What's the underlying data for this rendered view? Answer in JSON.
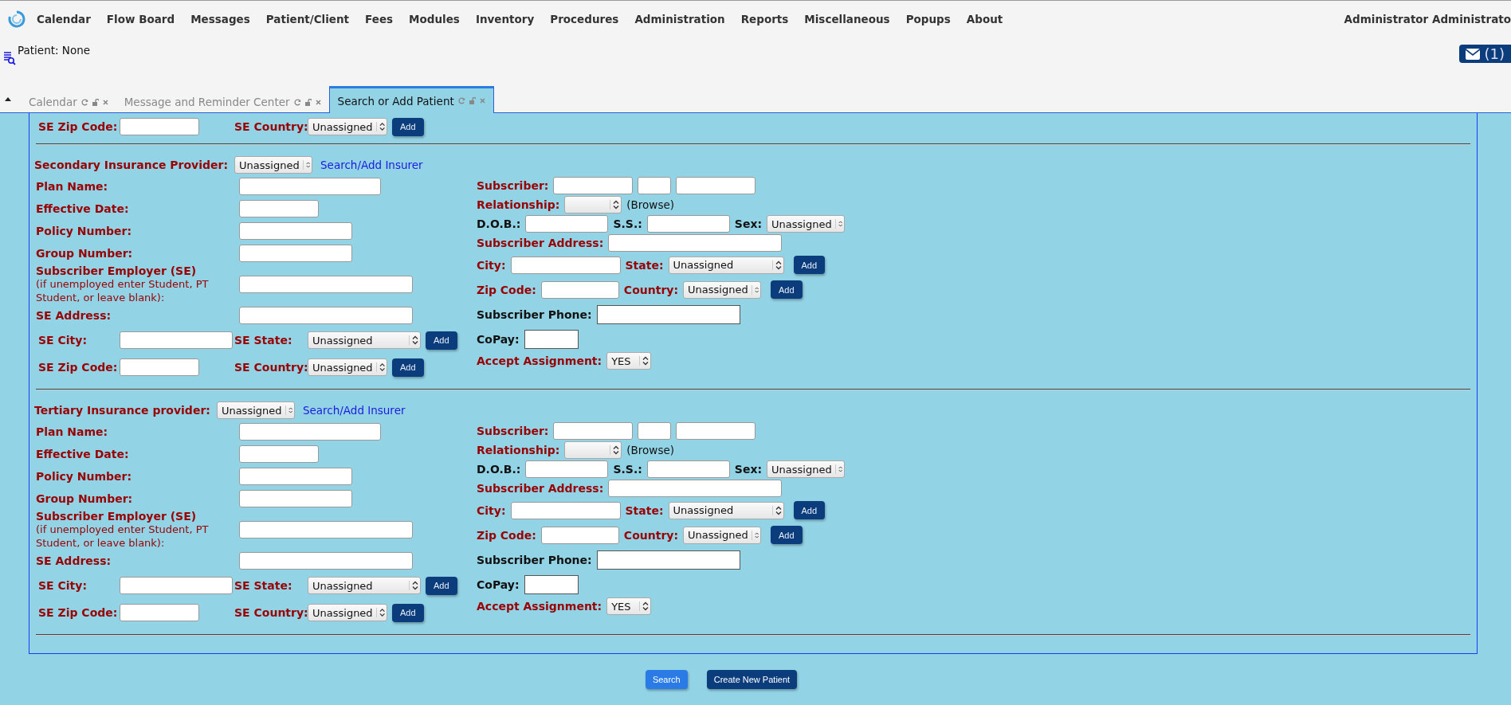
{
  "nav": {
    "menu": [
      "Calendar",
      "Flow Board",
      "Messages",
      "Patient/Client",
      "Fees",
      "Modules",
      "Inventory",
      "Procedures",
      "Administration",
      "Reports",
      "Miscellaneous",
      "Popups",
      "About"
    ],
    "user": "Administrator Administrato"
  },
  "patient_bar": {
    "label": "Patient: None",
    "messages": "(1)"
  },
  "tabs": [
    {
      "label": "Calendar",
      "selected": false
    },
    {
      "label": "Message and Reminder Center",
      "selected": false
    },
    {
      "label": "Search or Add Patient",
      "selected": true
    }
  ],
  "top_row": {
    "items": [
      {
        "kind": "label",
        "text": "SE Zip Code:",
        "required": true
      },
      {
        "kind": "input"
      },
      {
        "kind": "label",
        "text": "SE Country:",
        "required": true
      },
      {
        "kind": "select",
        "value": "Unassigned"
      },
      {
        "kind": "button",
        "text": "Add"
      }
    ]
  },
  "sections": [
    {
      "title": "Secondary Insurance Provider:",
      "provider": "Unassigned",
      "link": "Search/Add Insurer",
      "left_rows": [
        {
          "kind": "pair",
          "label": "Plan Name:"
        },
        {
          "kind": "pair",
          "label": "Effective Date:"
        },
        {
          "kind": "pair",
          "label": "Policy Number:"
        },
        {
          "kind": "pair",
          "label": "Group Number:"
        },
        {
          "kind": "pair",
          "label": "Subscriber Employer (SE)",
          "note": "(if unemployed enter Student, PT Student, or leave blank):"
        },
        {
          "kind": "pair",
          "label": "SE Address:"
        },
        {
          "kind": "inline",
          "items": [
            {
              "kind": "label",
              "text": "SE City:",
              "required": true
            },
            {
              "kind": "input"
            },
            {
              "kind": "label",
              "text": "SE State:",
              "required": true
            },
            {
              "kind": "select",
              "value": "Unassigned"
            },
            {
              "kind": "button",
              "text": "Add"
            }
          ]
        },
        {
          "kind": "inline",
          "items": [
            {
              "kind": "label",
              "text": "SE Zip Code:",
              "required": true
            },
            {
              "kind": "input"
            },
            {
              "kind": "label",
              "text": "SE Country:",
              "required": true
            },
            {
              "kind": "select",
              "value": "Unassigned"
            },
            {
              "kind": "button",
              "text": "Add"
            }
          ]
        }
      ],
      "right_rows": [
        {
          "items": [
            {
              "kind": "label",
              "text": "Subscriber:",
              "required": true
            },
            {
              "kind": "input"
            },
            {
              "kind": "input"
            },
            {
              "kind": "input"
            }
          ]
        },
        {
          "items": [
            {
              "kind": "label",
              "text": "Relationship:",
              "required": true
            },
            {
              "kind": "select"
            },
            {
              "kind": "note",
              "text": "(Browse)"
            }
          ]
        },
        {
          "items": [
            {
              "kind": "label",
              "text": "D.O.B.:",
              "required": false
            },
            {
              "kind": "input"
            },
            {
              "kind": "label",
              "text": "S.S.:",
              "required": false
            },
            {
              "kind": "input"
            },
            {
              "kind": "label",
              "text": "Sex:",
              "required": false
            },
            {
              "kind": "select",
              "value": "Unassigned"
            }
          ]
        },
        {
          "items": [
            {
              "kind": "label",
              "text": "Subscriber Address:",
              "required": true
            },
            {
              "kind": "input"
            }
          ]
        },
        {
          "items": [
            {
              "kind": "label",
              "text": "City:",
              "required": true
            },
            {
              "kind": "input"
            },
            {
              "kind": "label",
              "text": "State:",
              "required": true
            },
            {
              "kind": "select",
              "value": "Unassigned"
            },
            {
              "kind": "button",
              "text": "Add"
            }
          ]
        },
        {
          "items": [
            {
              "kind": "label",
              "text": "Zip Code:",
              "required": true
            },
            {
              "kind": "input"
            },
            {
              "kind": "label",
              "text": "Country:",
              "required": true
            },
            {
              "kind": "select",
              "value": "Unassigned"
            },
            {
              "kind": "button",
              "text": "Add"
            }
          ]
        },
        {
          "items": [
            {
              "kind": "label",
              "text": "Subscriber Phone:",
              "required": false
            },
            {
              "kind": "box"
            }
          ]
        },
        {
          "items": [
            {
              "kind": "label",
              "text": "CoPay:",
              "required": false
            },
            {
              "kind": "box"
            }
          ]
        },
        {
          "items": [
            {
              "kind": "label",
              "text": "Accept Assignment:",
              "required": true
            },
            {
              "kind": "select",
              "value": "YES"
            }
          ]
        }
      ]
    },
    {
      "title": "Tertiary Insurance provider:",
      "provider": "Unassigned",
      "link": "Search/Add Insurer",
      "left_rows": [
        {
          "kind": "pair",
          "label": "Plan Name:"
        },
        {
          "kind": "pair",
          "label": "Effective Date:"
        },
        {
          "kind": "pair",
          "label": "Policy Number:"
        },
        {
          "kind": "pair",
          "label": "Group Number:"
        },
        {
          "kind": "pair",
          "label": "Subscriber Employer (SE)",
          "note": "(if unemployed enter Student, PT Student, or leave blank):"
        },
        {
          "kind": "pair",
          "label": "SE Address:"
        },
        {
          "kind": "inline",
          "items": [
            {
              "kind": "label",
              "text": "SE City:",
              "required": true
            },
            {
              "kind": "input"
            },
            {
              "kind": "label",
              "text": "SE State:",
              "required": true
            },
            {
              "kind": "select",
              "value": "Unassigned"
            },
            {
              "kind": "button",
              "text": "Add"
            }
          ]
        },
        {
          "kind": "inline",
          "items": [
            {
              "kind": "label",
              "text": "SE Zip Code:",
              "required": true
            },
            {
              "kind": "input"
            },
            {
              "kind": "label",
              "text": "SE Country:",
              "required": true
            },
            {
              "kind": "select",
              "value": "Unassigned"
            },
            {
              "kind": "button",
              "text": "Add"
            }
          ]
        }
      ],
      "right_rows": [
        {
          "items": [
            {
              "kind": "label",
              "text": "Subscriber:",
              "required": true
            },
            {
              "kind": "input"
            },
            {
              "kind": "input"
            },
            {
              "kind": "input"
            }
          ]
        },
        {
          "items": [
            {
              "kind": "label",
              "text": "Relationship:",
              "required": true
            },
            {
              "kind": "select"
            },
            {
              "kind": "note",
              "text": "(Browse)"
            }
          ]
        },
        {
          "items": [
            {
              "kind": "label",
              "text": "D.O.B.:",
              "required": false
            },
            {
              "kind": "input"
            },
            {
              "kind": "label",
              "text": "S.S.:",
              "required": false
            },
            {
              "kind": "input"
            },
            {
              "kind": "label",
              "text": "Sex:",
              "required": false
            },
            {
              "kind": "select",
              "value": "Unassigned"
            }
          ]
        },
        {
          "items": [
            {
              "kind": "label",
              "text": "Subscriber Address:",
              "required": true
            },
            {
              "kind": "input"
            }
          ]
        },
        {
          "items": [
            {
              "kind": "label",
              "text": "City:",
              "required": true
            },
            {
              "kind": "input"
            },
            {
              "kind": "label",
              "text": "State:",
              "required": true
            },
            {
              "kind": "select",
              "value": "Unassigned"
            },
            {
              "kind": "button",
              "text": "Add"
            }
          ]
        },
        {
          "items": [
            {
              "kind": "label",
              "text": "Zip Code:",
              "required": true
            },
            {
              "kind": "input"
            },
            {
              "kind": "label",
              "text": "Country:",
              "required": true
            },
            {
              "kind": "select",
              "value": "Unassigned"
            },
            {
              "kind": "button",
              "text": "Add"
            }
          ]
        },
        {
          "items": [
            {
              "kind": "label",
              "text": "Subscriber Phone:",
              "required": false
            },
            {
              "kind": "box"
            }
          ]
        },
        {
          "items": [
            {
              "kind": "label",
              "text": "CoPay:",
              "required": false
            },
            {
              "kind": "box"
            }
          ]
        },
        {
          "items": [
            {
              "kind": "label",
              "text": "Accept Assignment:",
              "required": true
            },
            {
              "kind": "select",
              "value": "YES"
            }
          ]
        }
      ]
    }
  ],
  "actions": [
    {
      "label": "Search",
      "kind": "primary"
    },
    {
      "label": "Create New Patient",
      "kind": "dark"
    }
  ]
}
